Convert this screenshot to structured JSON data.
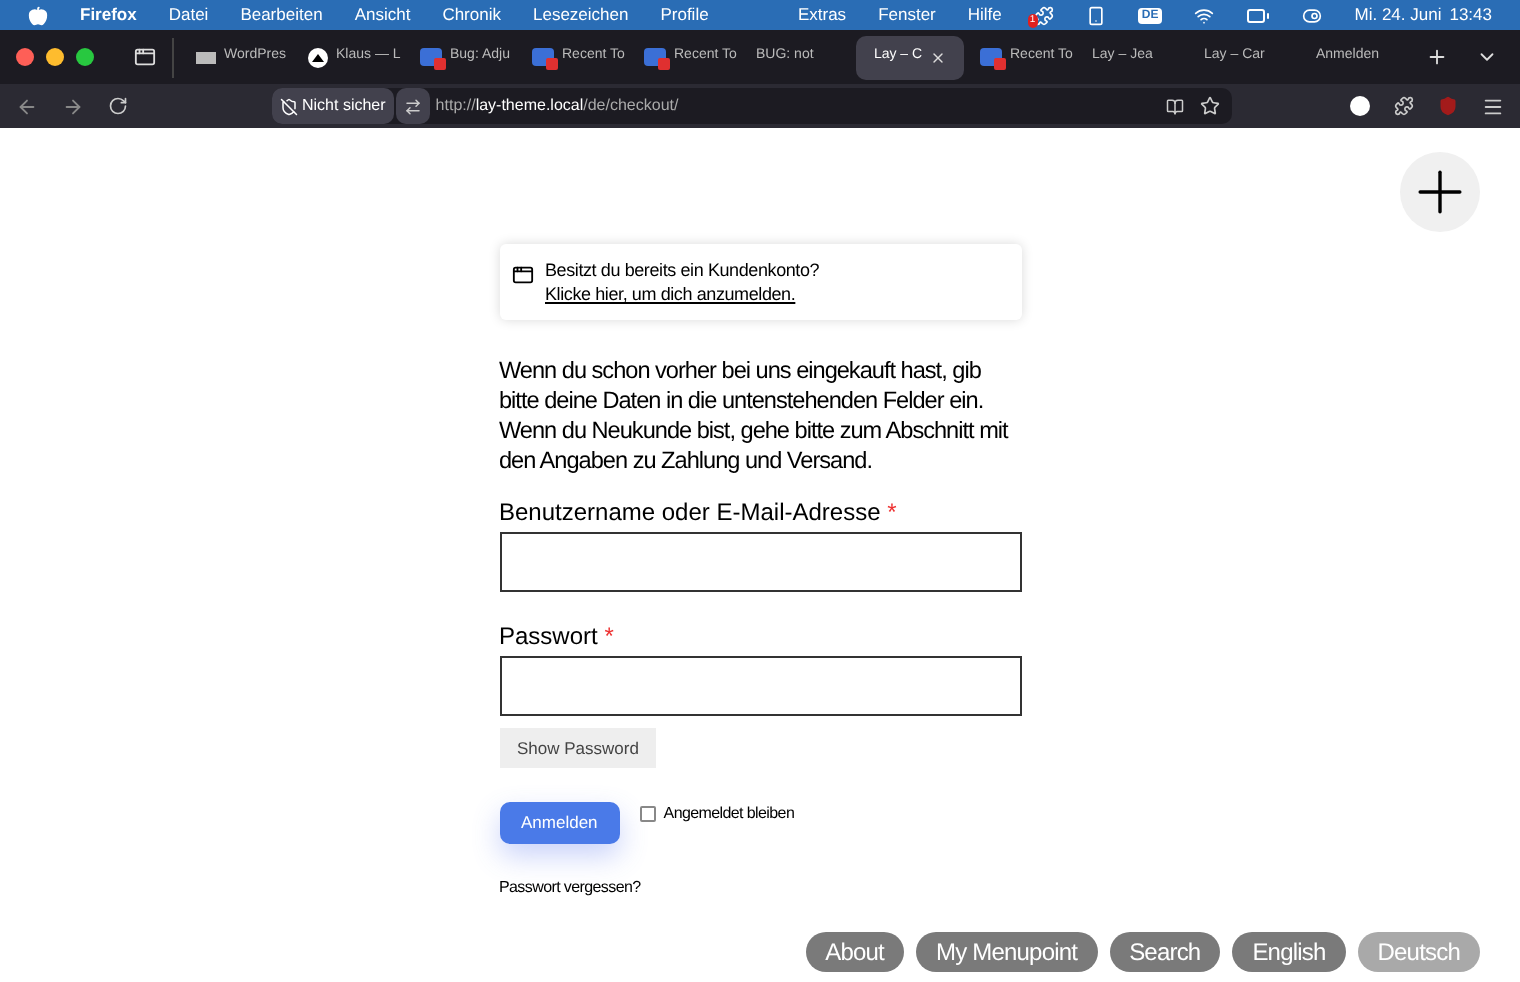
{
  "menubar": {
    "app": "Firefox",
    "menus": [
      "Datei",
      "Bearbeiten",
      "Ansicht",
      "Chronik",
      "Lesezeichen",
      "Profile",
      "Extras",
      "Fenster",
      "Hilfe"
    ],
    "input_source": "DE",
    "notification_count": "1",
    "date": "Mi. 24. Juni",
    "time": "13:43"
  },
  "tabs": [
    {
      "label": "WordPres",
      "selected": false,
      "kind": "wp"
    },
    {
      "label": "Klaus — L",
      "selected": false,
      "kind": "dark"
    },
    {
      "label": "Bug: Adju",
      "selected": false,
      "kind": "bug"
    },
    {
      "label": "Recent To",
      "selected": false,
      "kind": "bug"
    },
    {
      "label": "Recent To",
      "selected": false,
      "kind": "bug"
    },
    {
      "label": "BUG: not",
      "selected": false,
      "kind": "none"
    },
    {
      "label": "Lay – C",
      "selected": true,
      "kind": "none"
    },
    {
      "label": "Recent To",
      "selected": false,
      "kind": "bug"
    },
    {
      "label": "Lay – Jea",
      "selected": false,
      "kind": "none"
    },
    {
      "label": "Lay – Car",
      "selected": false,
      "kind": "none"
    },
    {
      "label": "Anmelden",
      "selected": false,
      "kind": "none"
    }
  ],
  "address_bar": {
    "security": "Nicht sicher",
    "scheme": "http://",
    "host": "lay-theme.local",
    "path": "/de/checkout/"
  },
  "notice": {
    "text": "Besitzt du bereits ein Kundenkonto?",
    "link": "Klicke hier, um dich anzumelden."
  },
  "intro": "Wenn du schon vorher bei uns eingekauft hast, gib bitte deine Daten in die untenstehenden Felder ein. Wenn du Neukunde bist, gehe bitte zum Abschnitt mit den Angaben zu Zahlung und Versand.",
  "fields": [
    {
      "label": "Benutzername oder E-Mail-Adresse",
      "required": "*"
    },
    {
      "label": "Passwort",
      "required": "*"
    }
  ],
  "show_password": "Show Password",
  "login_button": "Anmelden",
  "remember": {
    "label": "Angemeldet bleiben",
    "checked": false
  },
  "lost_password": "Passwort vergessen?",
  "nav": [
    {
      "label": "About",
      "selected": false
    },
    {
      "label": "My Menupoint",
      "selected": false
    },
    {
      "label": "Search",
      "selected": false
    },
    {
      "label": "English",
      "selected": false
    },
    {
      "label": "Deutsch",
      "selected": true
    }
  ]
}
